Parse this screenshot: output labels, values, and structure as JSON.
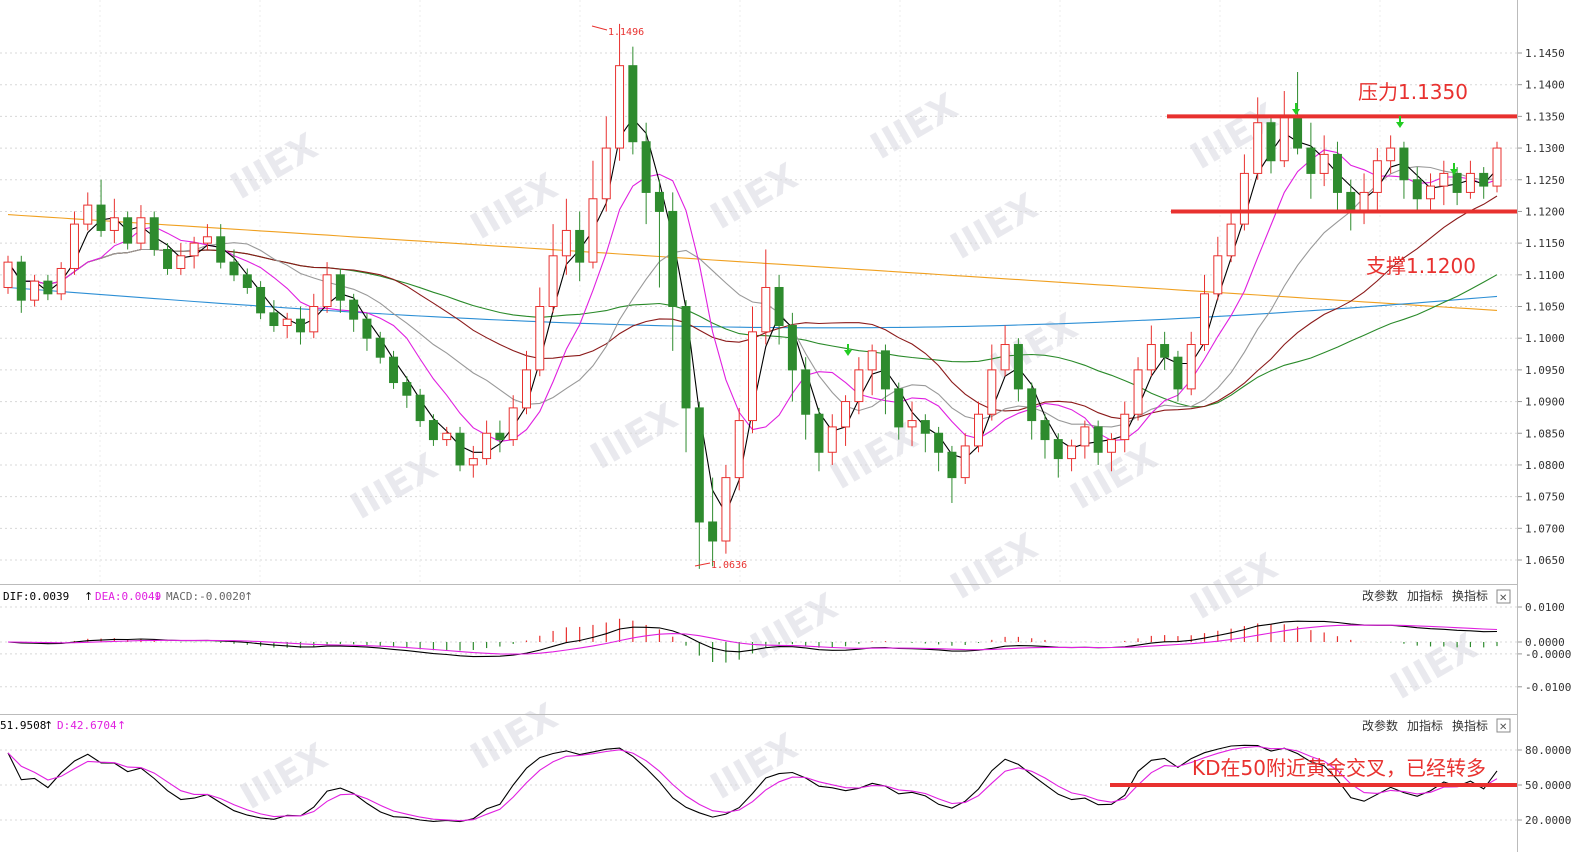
{
  "chart_data": [
    {
      "type": "candlestick",
      "symbol_note": "",
      "ylim": [
        1.06,
        1.15
      ],
      "y_ticks": [
        "1.1450",
        "1.1400",
        "1.1350",
        "1.1300",
        "1.1250",
        "1.1200",
        "1.1150",
        "1.1100",
        "1.1050",
        "1.1000",
        "1.0950",
        "1.0900",
        "1.0850",
        "1.0800",
        "1.0750",
        "1.0700",
        "1.0650"
      ],
      "high_label": "1.1496",
      "low_label": "1.0636",
      "annotations": {
        "resistance_label": "压力1.1350",
        "resistance_level": 1.135,
        "support_label": "支撑1.1200",
        "support_level": 1.12
      },
      "candles": [
        [
          1.108,
          1.112,
          1.113,
          1.107
        ],
        [
          1.112,
          1.106,
          1.113,
          1.104
        ],
        [
          1.106,
          1.109,
          1.11,
          1.105
        ],
        [
          1.109,
          1.107,
          1.11,
          1.106
        ],
        [
          1.107,
          1.111,
          1.112,
          1.106
        ],
        [
          1.111,
          1.118,
          1.12,
          1.11
        ],
        [
          1.118,
          1.121,
          1.123,
          1.117
        ],
        [
          1.121,
          1.117,
          1.125,
          1.116
        ],
        [
          1.117,
          1.119,
          1.122,
          1.115
        ],
        [
          1.119,
          1.115,
          1.12,
          1.114
        ],
        [
          1.115,
          1.119,
          1.121,
          1.114
        ],
        [
          1.119,
          1.114,
          1.12,
          1.113
        ],
        [
          1.114,
          1.111,
          1.115,
          1.11
        ],
        [
          1.111,
          1.113,
          1.115,
          1.11
        ],
        [
          1.113,
          1.115,
          1.116,
          1.111
        ],
        [
          1.115,
          1.116,
          1.118,
          1.114
        ],
        [
          1.116,
          1.112,
          1.118,
          1.111
        ],
        [
          1.112,
          1.11,
          1.114,
          1.109
        ],
        [
          1.11,
          1.108,
          1.111,
          1.107
        ],
        [
          1.108,
          1.104,
          1.109,
          1.103
        ],
        [
          1.104,
          1.102,
          1.106,
          1.101
        ],
        [
          1.102,
          1.103,
          1.104,
          1.1
        ],
        [
          1.103,
          1.101,
          1.105,
          1.099
        ],
        [
          1.101,
          1.105,
          1.107,
          1.1
        ],
        [
          1.105,
          1.11,
          1.112,
          1.104
        ],
        [
          1.11,
          1.106,
          1.111,
          1.104
        ],
        [
          1.106,
          1.103,
          1.107,
          1.101
        ],
        [
          1.103,
          1.1,
          1.104,
          1.098
        ],
        [
          1.1,
          1.097,
          1.101,
          1.096
        ],
        [
          1.097,
          1.093,
          1.098,
          1.092
        ],
        [
          1.093,
          1.091,
          1.094,
          1.089
        ],
        [
          1.091,
          1.087,
          1.092,
          1.086
        ],
        [
          1.087,
          1.084,
          1.088,
          1.083
        ],
        [
          1.084,
          1.085,
          1.086,
          1.083
        ],
        [
          1.085,
          1.08,
          1.086,
          1.079
        ],
        [
          1.08,
          1.081,
          1.083,
          1.078
        ],
        [
          1.081,
          1.085,
          1.087,
          1.08
        ],
        [
          1.085,
          1.084,
          1.087,
          1.082
        ],
        [
          1.084,
          1.089,
          1.091,
          1.083
        ],
        [
          1.089,
          1.095,
          1.098,
          1.088
        ],
        [
          1.095,
          1.105,
          1.108,
          1.094
        ],
        [
          1.105,
          1.113,
          1.118,
          1.104
        ],
        [
          1.113,
          1.117,
          1.122,
          1.11
        ],
        [
          1.117,
          1.112,
          1.12,
          1.109
        ],
        [
          1.112,
          1.122,
          1.128,
          1.111
        ],
        [
          1.122,
          1.13,
          1.135,
          1.12
        ],
        [
          1.13,
          1.143,
          1.1496,
          1.128
        ],
        [
          1.143,
          1.131,
          1.146,
          1.129
        ],
        [
          1.131,
          1.123,
          1.134,
          1.118
        ],
        [
          1.123,
          1.12,
          1.125,
          1.108
        ],
        [
          1.12,
          1.105,
          1.123,
          1.098
        ],
        [
          1.105,
          1.089,
          1.106,
          1.082
        ],
        [
          1.089,
          1.071,
          1.09,
          1.0636
        ],
        [
          1.071,
          1.068,
          1.078,
          1.064
        ],
        [
          1.068,
          1.078,
          1.08,
          1.066
        ],
        [
          1.078,
          1.087,
          1.089,
          1.076
        ],
        [
          1.087,
          1.101,
          1.105,
          1.085
        ],
        [
          1.101,
          1.108,
          1.114,
          1.099
        ],
        [
          1.108,
          1.102,
          1.11,
          1.099
        ],
        [
          1.102,
          1.095,
          1.104,
          1.09
        ],
        [
          1.095,
          1.088,
          1.097,
          1.084
        ],
        [
          1.088,
          1.082,
          1.089,
          1.079
        ],
        [
          1.082,
          1.086,
          1.088,
          1.08
        ],
        [
          1.086,
          1.09,
          1.091,
          1.083
        ],
        [
          1.09,
          1.095,
          1.097,
          1.088
        ],
        [
          1.095,
          1.098,
          1.099,
          1.091
        ],
        [
          1.098,
          1.092,
          1.099,
          1.088
        ],
        [
          1.092,
          1.086,
          1.093,
          1.084
        ],
        [
          1.086,
          1.087,
          1.09,
          1.083
        ],
        [
          1.087,
          1.085,
          1.088,
          1.082
        ],
        [
          1.085,
          1.082,
          1.086,
          1.079
        ],
        [
          1.082,
          1.078,
          1.083,
          1.074
        ],
        [
          1.078,
          1.083,
          1.085,
          1.077
        ],
        [
          1.083,
          1.088,
          1.09,
          1.082
        ],
        [
          1.088,
          1.095,
          1.099,
          1.087
        ],
        [
          1.095,
          1.099,
          1.102,
          1.094
        ],
        [
          1.099,
          1.092,
          1.1,
          1.09
        ],
        [
          1.092,
          1.087,
          1.093,
          1.084
        ],
        [
          1.087,
          1.084,
          1.088,
          1.081
        ],
        [
          1.084,
          1.081,
          1.085,
          1.078
        ],
        [
          1.081,
          1.083,
          1.084,
          1.079
        ],
        [
          1.083,
          1.086,
          1.087,
          1.081
        ],
        [
          1.086,
          1.082,
          1.087,
          1.08
        ],
        [
          1.082,
          1.084,
          1.085,
          1.079
        ],
        [
          1.084,
          1.088,
          1.09,
          1.082
        ],
        [
          1.088,
          1.095,
          1.097,
          1.087
        ],
        [
          1.095,
          1.099,
          1.102,
          1.094
        ],
        [
          1.099,
          1.097,
          1.101,
          1.095
        ],
        [
          1.097,
          1.092,
          1.098,
          1.09
        ],
        [
          1.092,
          1.099,
          1.101,
          1.091
        ],
        [
          1.099,
          1.107,
          1.11,
          1.098
        ],
        [
          1.107,
          1.113,
          1.116,
          1.106
        ],
        [
          1.113,
          1.118,
          1.12,
          1.112
        ],
        [
          1.118,
          1.126,
          1.129,
          1.117
        ],
        [
          1.126,
          1.134,
          1.138,
          1.125
        ],
        [
          1.134,
          1.128,
          1.135,
          1.126
        ],
        [
          1.128,
          1.135,
          1.139,
          1.127
        ],
        [
          1.135,
          1.13,
          1.142,
          1.129
        ],
        [
          1.13,
          1.126,
          1.134,
          1.122
        ],
        [
          1.126,
          1.129,
          1.132,
          1.124
        ],
        [
          1.129,
          1.123,
          1.131,
          1.12
        ],
        [
          1.123,
          1.12,
          1.125,
          1.117
        ],
        [
          1.12,
          1.123,
          1.126,
          1.118
        ],
        [
          1.123,
          1.128,
          1.13,
          1.12
        ],
        [
          1.128,
          1.13,
          1.132,
          1.126
        ],
        [
          1.13,
          1.125,
          1.131,
          1.122
        ],
        [
          1.125,
          1.122,
          1.127,
          1.12
        ],
        [
          1.122,
          1.124,
          1.126,
          1.12
        ],
        [
          1.124,
          1.126,
          1.128,
          1.121
        ],
        [
          1.126,
          1.123,
          1.127,
          1.121
        ],
        [
          1.123,
          1.126,
          1.128,
          1.122
        ],
        [
          1.126,
          1.124,
          1.127,
          1.122
        ],
        [
          1.124,
          1.13,
          1.131,
          1.123
        ]
      ]
    },
    {
      "type": "line",
      "panel": "MACD",
      "legend": {
        "dif": "DIF:0.0039",
        "dea": "DEA:0.0049",
        "macd": "MACD:-0.0020"
      },
      "y_ticks": [
        "0.0100",
        "0.0000",
        "-0.0000",
        "-0.0100"
      ],
      "ylim": [
        -0.011,
        0.011
      ]
    },
    {
      "type": "line",
      "panel": "KD",
      "legend": {
        "k": "51.9508",
        "d": "D:42.6704"
      },
      "y_ticks": [
        "80.0000",
        "50.0000",
        "20.0000"
      ],
      "ylim": [
        10,
        100
      ],
      "annotation": {
        "text": "KD在50附近黄金交叉，已经转多",
        "level": 50
      }
    }
  ],
  "toolbar": {
    "params": "改参数",
    "add": "加指标",
    "switch": "换指标",
    "close": "✕"
  },
  "colors": {
    "up": "#e8312f",
    "down": "#2e8b2e",
    "ma5": "#000000",
    "ma10": "#e020e0",
    "ma20": "#999999",
    "ma30": "#8b1a1a",
    "ma60": "#2a8a2a",
    "ma120": "#2d8fd5",
    "ma250": "#f0a020",
    "annotation": "#e8312f"
  },
  "watermark": "IIIEX"
}
